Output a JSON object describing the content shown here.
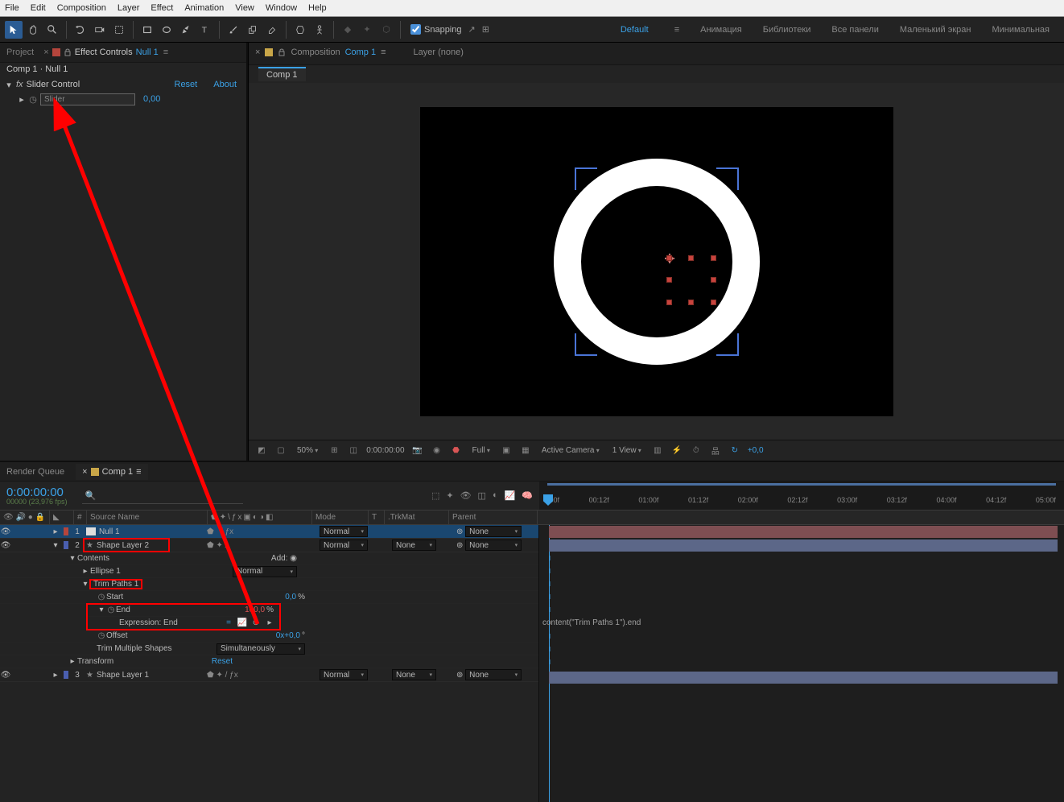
{
  "menu": {
    "items": [
      "File",
      "Edit",
      "Composition",
      "Layer",
      "Effect",
      "Animation",
      "View",
      "Window",
      "Help"
    ]
  },
  "toolbar": {
    "snapping_label": "Snapping",
    "workspaces": [
      "Default",
      "Анимация",
      "Библиотеки",
      "Все панели",
      "Маленький экран",
      "Минимальная"
    ],
    "active_workspace": "Default"
  },
  "effect_controls": {
    "tab_project": "Project",
    "tab_ec_prefix": "Effect Controls",
    "tab_ec_layer": "Null 1",
    "breadcrumb": "Comp 1 · Null 1",
    "fx_name": "Slider Control",
    "reset": "Reset",
    "about": "About",
    "prop_name": "Slider",
    "prop_value": "0,00"
  },
  "viewer": {
    "tab_comp_prefix": "Composition",
    "tab_comp_name": "Comp 1",
    "layer_none": "Layer (none)",
    "subtab": "Comp 1"
  },
  "viewer_footer": {
    "zoom": "50%",
    "timecode": "0:00:00:00",
    "res": "Full",
    "camera": "Active Camera",
    "views": "1 View",
    "exposure": "+0,0"
  },
  "timeline": {
    "tabs": {
      "render_queue": "Render Queue",
      "comp": "Comp 1"
    },
    "timecode": "0:00:00:00",
    "timecode_sub": "00000 (23,976 fps)",
    "ruler_ticks": [
      ":00f",
      "00:12f",
      "01:00f",
      "01:12f",
      "02:00f",
      "02:12f",
      "03:00f",
      "03:12f",
      "04:00f",
      "04:12f",
      "05:00f"
    ],
    "col_headers": {
      "num": "#",
      "src": "Source Name",
      "mode": "Mode",
      "t": "T",
      "trkmat": ".TrkMat",
      "parent": "Parent"
    },
    "layers": [
      {
        "num": "1",
        "color": "#b5453c",
        "icon": "null",
        "name": "Null 1",
        "mode": "Normal",
        "trkmat": "",
        "parent": "None"
      },
      {
        "num": "2",
        "color": "#4a5fb0",
        "icon": "star",
        "name": "Shape Layer 2",
        "mode": "Normal",
        "trkmat": "None",
        "parent": "None"
      },
      {
        "num": "3",
        "color": "#4a5fb0",
        "icon": "star",
        "name": "Shape Layer 1",
        "mode": "Normal",
        "trkmat": "None",
        "parent": "None"
      }
    ],
    "props": {
      "contents": "Contents",
      "add": "Add:",
      "ellipse": "Ellipse 1",
      "ellipse_mode": "Normal",
      "trim": "Trim Paths 1",
      "start": "Start",
      "start_val": "0,0",
      "pct": "%",
      "end": "End",
      "end_val": "100,0",
      "expr_end": "Expression: End",
      "offset": "Offset",
      "offset_val": "0x+0,0",
      "deg": "°",
      "trim_multi": "Trim Multiple Shapes",
      "trim_multi_val": "Simultaneously",
      "transform": "Transform",
      "transform_reset": "Reset",
      "expr_text": "content(\"Trim Paths 1\").end"
    }
  }
}
